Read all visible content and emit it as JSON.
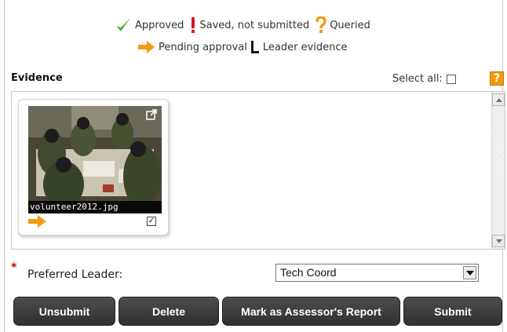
{
  "legend": {
    "approved": "Approved",
    "saved": "Saved, not submitted",
    "queried": "Queried",
    "pending": "Pending approval",
    "leader": "Leader evidence"
  },
  "colors": {
    "approved": "#5bb135",
    "saved": "#e3141d",
    "queried": "#f39a12",
    "pending": "#f39a12",
    "button": "#3a3a3a"
  },
  "evidence": {
    "title": "Evidence",
    "select_all_label": "Select all:",
    "select_all_checked": false,
    "help_label": "?",
    "items": [
      {
        "filename": "volunteer2012.jpg",
        "status_icon": "pending-arrow-icon",
        "checked": true,
        "check_glyph": "✓"
      }
    ]
  },
  "form": {
    "required_marker": "*",
    "leader_label": "Preferred Leader:",
    "leader_value": "Tech Coord"
  },
  "buttons": {
    "unsubmit": "Unsubmit",
    "delete": "Delete",
    "assessor": "Mark as Assessor's Report",
    "submit": "Submit"
  }
}
